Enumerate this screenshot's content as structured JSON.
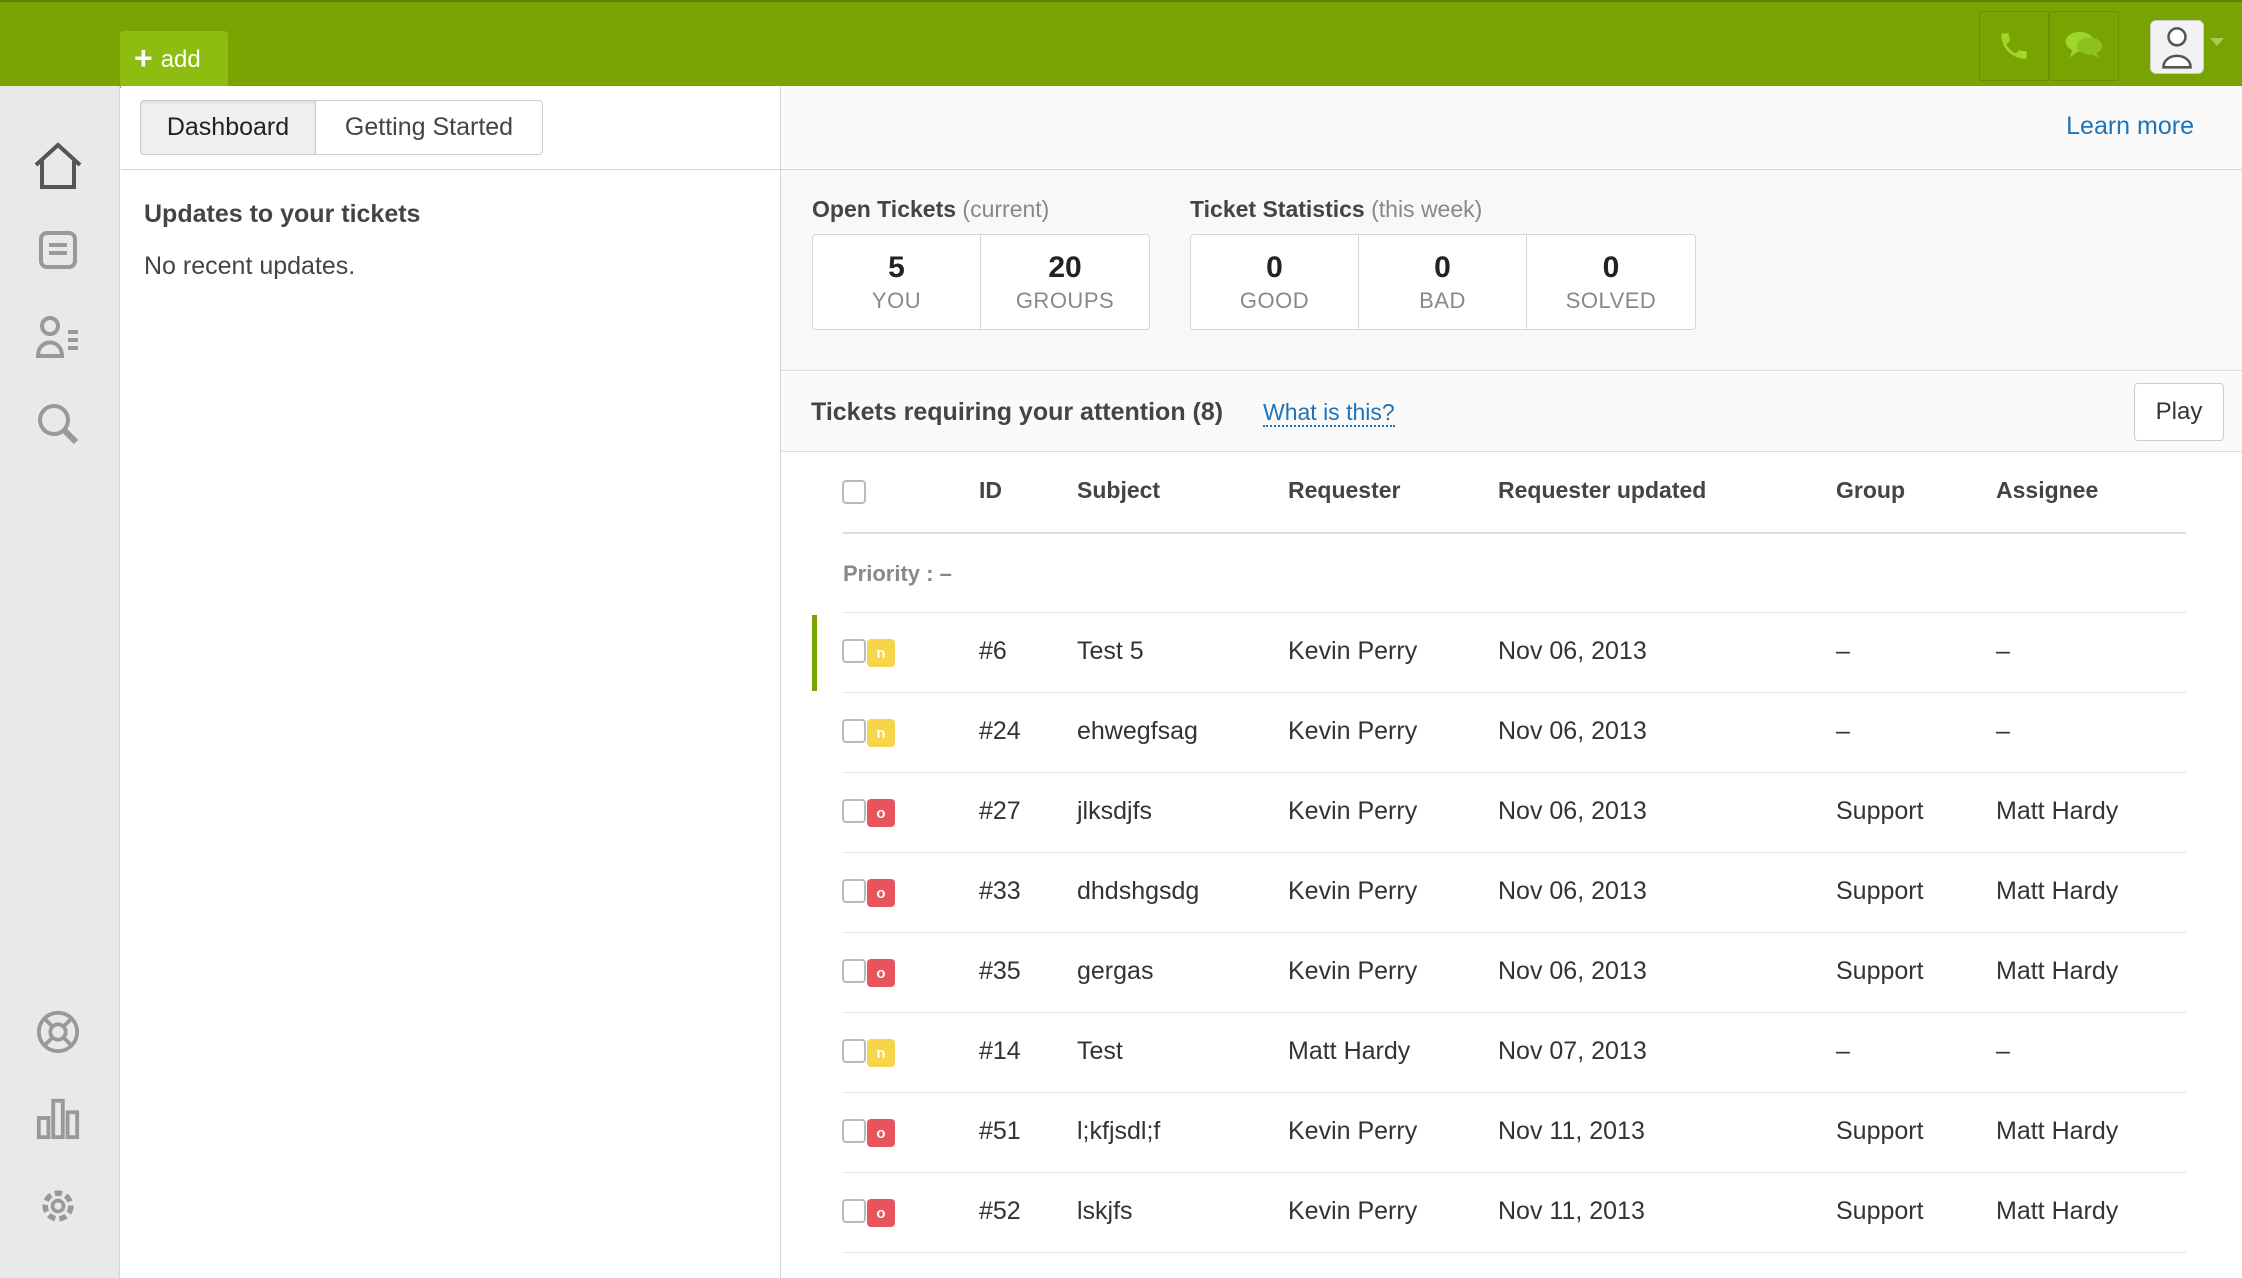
{
  "topbar": {
    "add_label": "add",
    "accent_color": "#78a300"
  },
  "sidebar": {
    "items": [
      {
        "icon": "home-icon"
      },
      {
        "icon": "views-icon"
      },
      {
        "icon": "customers-icon"
      },
      {
        "icon": "search-icon"
      },
      {
        "icon": "help-center-icon"
      },
      {
        "icon": "reporting-icon"
      },
      {
        "icon": "settings-icon"
      }
    ]
  },
  "tabs": [
    {
      "label": "Dashboard",
      "active": true
    },
    {
      "label": "Getting Started",
      "active": false
    }
  ],
  "updates": {
    "title": "Updates to your tickets",
    "empty": "No recent updates."
  },
  "header": {
    "learn_more": "Learn more"
  },
  "open_tickets": {
    "title": "Open Tickets",
    "qualifier": "(current)",
    "cells": [
      {
        "value": "5",
        "label": "YOU"
      },
      {
        "value": "20",
        "label": "GROUPS"
      }
    ]
  },
  "ticket_stats": {
    "title": "Ticket Statistics",
    "qualifier": "(this week)",
    "cells": [
      {
        "value": "0",
        "label": "GOOD"
      },
      {
        "value": "0",
        "label": "BAD"
      },
      {
        "value": "0",
        "label": "SOLVED"
      }
    ]
  },
  "views": {
    "title": "Tickets requiring your attention (8)",
    "help_link": "What is this?",
    "play_label": "Play"
  },
  "table": {
    "columns": [
      "ID",
      "Subject",
      "Requester",
      "Requester updated",
      "Group",
      "Assignee"
    ],
    "group_label": "Priority : –",
    "rows": [
      {
        "status": "n",
        "id": "#6",
        "subject": "Test 5",
        "requester": "Kevin Perry",
        "updated": "Nov 06, 2013",
        "group": "–",
        "assignee": "–"
      },
      {
        "status": "n",
        "id": "#24",
        "subject": "ehwegfsag",
        "requester": "Kevin Perry",
        "updated": "Nov 06, 2013",
        "group": "–",
        "assignee": "–"
      },
      {
        "status": "o",
        "id": "#27",
        "subject": "jlksdjfs",
        "requester": "Kevin Perry",
        "updated": "Nov 06, 2013",
        "group": "Support",
        "assignee": "Matt Hardy"
      },
      {
        "status": "o",
        "id": "#33",
        "subject": "dhdshgsdg",
        "requester": "Kevin Perry",
        "updated": "Nov 06, 2013",
        "group": "Support",
        "assignee": "Matt Hardy"
      },
      {
        "status": "o",
        "id": "#35",
        "subject": "gergas",
        "requester": "Kevin Perry",
        "updated": "Nov 06, 2013",
        "group": "Support",
        "assignee": "Matt Hardy"
      },
      {
        "status": "n",
        "id": "#14",
        "subject": "Test",
        "requester": "Matt Hardy",
        "updated": "Nov 07, 2013",
        "group": "–",
        "assignee": "–"
      },
      {
        "status": "o",
        "id": "#51",
        "subject": "l;kfjsdl;f",
        "requester": "Kevin Perry",
        "updated": "Nov 11, 2013",
        "group": "Support",
        "assignee": "Matt Hardy"
      },
      {
        "status": "o",
        "id": "#52",
        "subject": "lskjfs",
        "requester": "Kevin Perry",
        "updated": "Nov 11, 2013",
        "group": "Support",
        "assignee": "Matt Hardy"
      }
    ]
  }
}
